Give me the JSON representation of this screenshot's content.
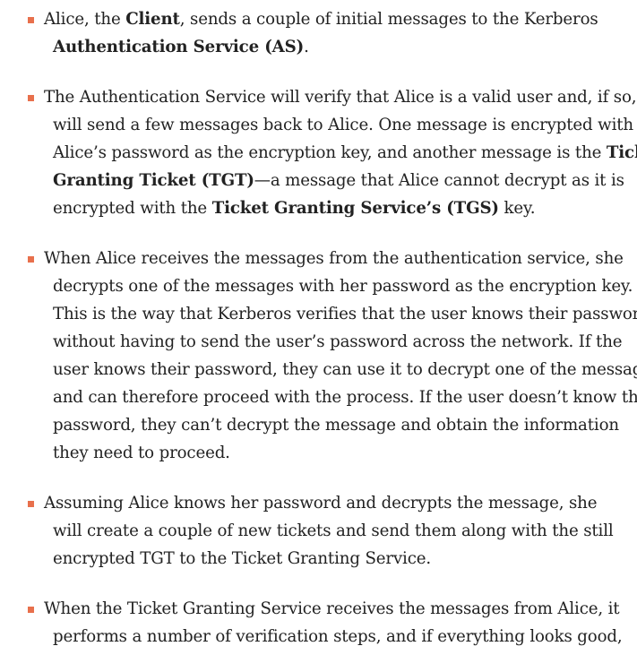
{
  "list": {
    "bullet_color": "#e8704c",
    "items": [
      {
        "lines": [
          [
            {
              "t": "Alice, the "
            },
            {
              "t": "Client",
              "b": true
            },
            {
              "t": ", sends a couple of initial messages to the Kerberos"
            }
          ],
          [
            {
              "t": "Authentication Service (AS)",
              "b": true
            },
            {
              "t": "."
            }
          ]
        ]
      },
      {
        "lines": [
          [
            {
              "t": "The Authentication Service will verify that Alice is a valid user and, if so,"
            }
          ],
          [
            {
              "t": "will send a few messages back to Alice. One message is encrypted with"
            }
          ],
          [
            {
              "t": "Alice’s password as the encryption key, and another message is the "
            },
            {
              "t": "Ticket",
              "b": true
            }
          ],
          [
            {
              "t": "Granting Ticket (TGT)",
              "b": true
            },
            {
              "t": "—a message that Alice cannot decrypt as it is"
            }
          ],
          [
            {
              "t": "encrypted with the "
            },
            {
              "t": "Ticket Granting Service’s (TGS)",
              "b": true
            },
            {
              "t": " key."
            }
          ]
        ]
      },
      {
        "lines": [
          [
            {
              "t": "When Alice receives the messages from the authentication service, she"
            }
          ],
          [
            {
              "t": "decrypts one of the messages with her password as the encryption key."
            }
          ],
          [
            {
              "t": "This is the way that Kerberos verifies that the user knows their password"
            }
          ],
          [
            {
              "t": "without having to send the user’s password across the network. If the"
            }
          ],
          [
            {
              "t": "user knows their password, they can use it to decrypt one of the messages"
            }
          ],
          [
            {
              "t": "and can therefore proceed with the process. If the user doesn’t know their"
            }
          ],
          [
            {
              "t": "password, they can’t decrypt the message and obtain the information"
            }
          ],
          [
            {
              "t": "they need to proceed."
            }
          ]
        ]
      },
      {
        "lines": [
          [
            {
              "t": "Assuming Alice knows her password and decrypts the message, she"
            }
          ],
          [
            {
              "t": "will create a couple of new tickets and send them along with the still"
            }
          ],
          [
            {
              "t": "encrypted TGT to the Ticket Granting Service."
            }
          ]
        ]
      },
      {
        "lines": [
          [
            {
              "t": "When the Ticket Granting Service receives the messages from Alice, it"
            }
          ],
          [
            {
              "t": "performs a number of verification steps, and if everything looks good,"
            }
          ]
        ]
      }
    ]
  }
}
